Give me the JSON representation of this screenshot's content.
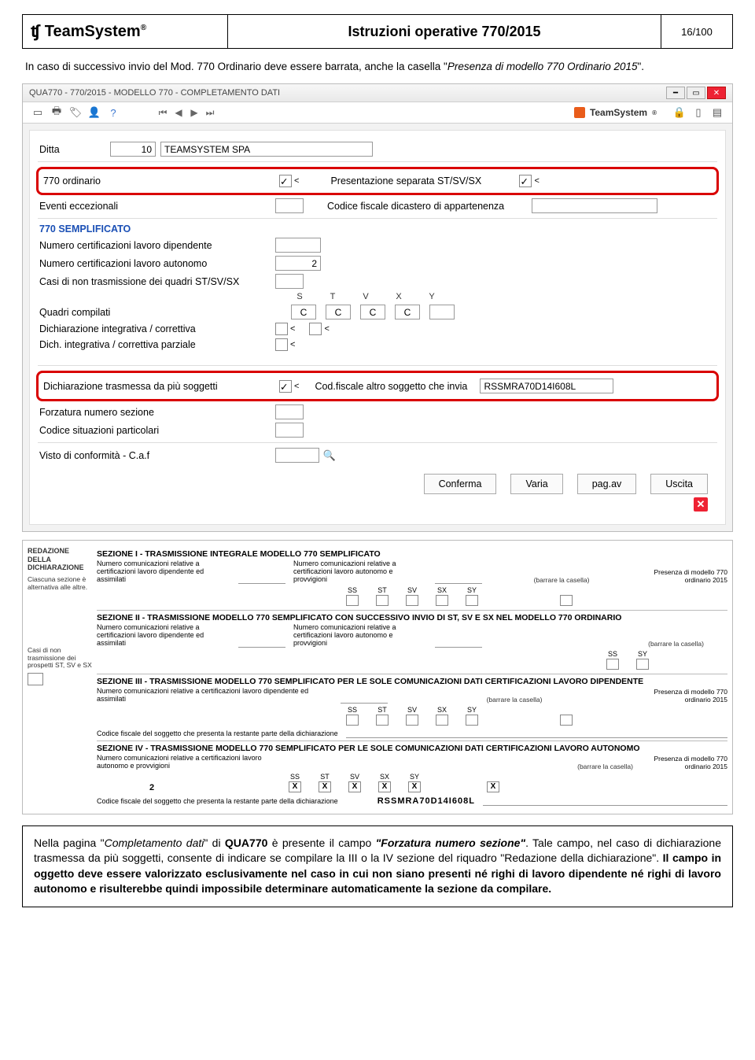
{
  "header": {
    "brand": "TeamSystem",
    "title": "Istruzioni operative 770/2015",
    "page": "16/100"
  },
  "intro": {
    "pre": "In caso di successivo invio del Mod. 770 Ordinario deve essere barrata, anche la casella \"",
    "ital": "Presenza di modello 770 Ordinario 2015",
    "post": "\"."
  },
  "win": {
    "title": "QUA770 - 770/2015 - MODELLO 770 - COMPLETAMENTO DATI",
    "brand": "TeamSystem"
  },
  "form": {
    "ditta_label": "Ditta",
    "ditta_num": "10",
    "ditta_name": "TEAMSYSTEM SPA",
    "l_770ord": "770 ordinario",
    "l_pres_sep": "Presentazione separata ST/SV/SX",
    "l_eventi": "Eventi eccezionali",
    "l_codfisc_dicast": "Codice fiscale dicastero di appartenenza",
    "sect_semplif": "770 SEMPLIFICATO",
    "l_num_dip": "Numero certificazioni lavoro dipendente",
    "l_num_aut": "Numero certificazioni lavoro autonomo",
    "v_num_aut": "2",
    "l_casi_non": "Casi di non trasmissione dei quadri ST/SV/SX",
    "letters": [
      "S",
      "T",
      "V",
      "X",
      "Y"
    ],
    "l_quadri": "Quadri compilati",
    "quadri_vals": [
      "C",
      "C",
      "C",
      "C",
      ""
    ],
    "l_dich_int": "Dichiarazione integrativa / correttiva",
    "l_dich_parz": "Dich. integrativa / correttiva parziale",
    "l_dich_trasm": "Dichiarazione trasmessa da più soggetti",
    "l_codfisc_altro": "Cod.fiscale altro soggetto che invia",
    "v_codfisc_altro": "RSSMRA70D14I608L",
    "l_forz": "Forzatura numero sezione",
    "l_cod_sit": "Codice situazioni particolari",
    "l_visto": "Visto di conformità - C.a.f",
    "btn_conf": "Conferma",
    "btn_varia": "Varia",
    "btn_pag": "pag.av",
    "btn_usc": "Uscita"
  },
  "shot2": {
    "red_title": "REDAZIONE DELLA DICHIARAZIONE",
    "red_sub": "Ciascuna sezione è alternativa alle altre.",
    "casi_left": "Casi di non trasmissione dei prospetti ST, SV e SX",
    "s1": "SEZIONE I - TRASMISSIONE INTEGRALE MODELLO 770 SEMPLIFICATO",
    "c1a": "Numero comunicazioni relative a certificazioni lavoro dipendente ed assimilati",
    "c1b": "Numero comunicazioni relative a certificazioni lavoro autonomo e provvigioni",
    "barrare": "(barrare la casella)",
    "pres_semp": "Presenza di modello 770 ordinario 2015",
    "chks": [
      "SS",
      "ST",
      "SV",
      "SX",
      "SY"
    ],
    "s2": "SEZIONE II - TRASMISSIONE MODELLO 770 SEMPLIFICATO CON SUCCESSIVO INVIO DI ST, SV E SX NEL MODELLO 770 ORDINARIO",
    "s3": "SEZIONE III - TRASMISSIONE MODELLO 770 SEMPLIFICATO PER LE SOLE COMUNICAZIONI DATI CERTIFICAZIONI LAVORO DIPENDENTE",
    "c3": "Numero comunicazioni relative a certificazioni lavoro dipendente ed assimilati",
    "codfisc_row": "Codice fiscale del soggetto che presenta la restante parte della dichiarazione",
    "s4": "SEZIONE IV - TRASMISSIONE MODELLO 770 SEMPLIFICATO PER LE SOLE COMUNICAZIONI DATI CERTIFICAZIONI LAVORO AUTONOMO",
    "c4": "Numero comunicazioni relative a certificazioni lavoro autonomo e provvigioni",
    "v4": "2",
    "cf_val": "RSSMRA70D14I608L"
  },
  "callout": {
    "t1": "Nella pagina \"",
    "t2": "Completamento dati",
    "t3": "\" di ",
    "t4": "QUA770",
    "t5": " è presente il campo ",
    "t6": "\"Forzatura numero sezione\"",
    "t7": ". Tale campo, nel caso di dichiarazione trasmessa da più soggetti, consente di indicare se compilare la III o la IV sezione del riquadro \"Redazione della dichiarazione\". ",
    "t8": "Il campo in oggetto deve essere valorizzato esclusivamente nel caso in cui non siano presenti né righi di lavoro dipendente né righi di lavoro autonomo e risulterebbe quindi impossibile determinare automaticamente la sezione da compilare."
  }
}
